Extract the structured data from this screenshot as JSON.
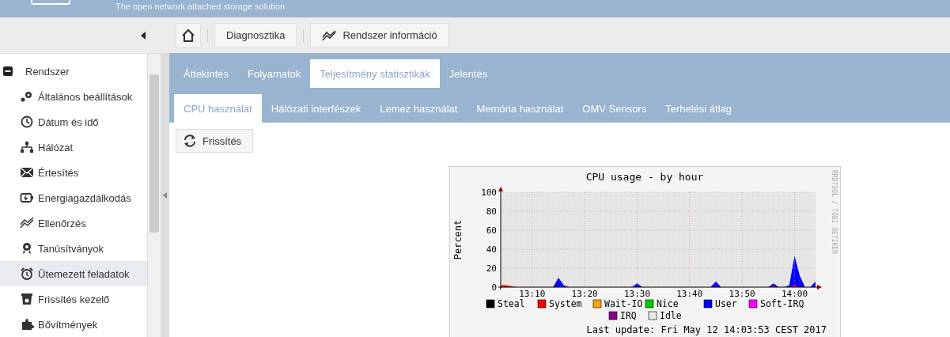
{
  "header": {
    "tagline": "The open network attached storage solution"
  },
  "breadcrumb": [
    {
      "label": "Diagnosztika"
    },
    {
      "label": "Rendszer információ"
    }
  ],
  "sidebar": {
    "group": {
      "label": "Rendszer",
      "expanded": true
    },
    "items": [
      {
        "label": "Általános beállítások",
        "selected": false
      },
      {
        "label": "Dátum és idő",
        "selected": false
      },
      {
        "label": "Hálózat",
        "selected": false
      },
      {
        "label": "Értesítés",
        "selected": false
      },
      {
        "label": "Energiagazdálkodás",
        "selected": false
      },
      {
        "label": "Ellenőrzés",
        "selected": false
      },
      {
        "label": "Tanúsítványok",
        "selected": false
      },
      {
        "label": "Ütemezett feladatok",
        "selected": true
      },
      {
        "label": "Frissítés kezelő",
        "selected": false
      },
      {
        "label": "Bővítmények",
        "selected": false
      }
    ]
  },
  "tabs": [
    {
      "label": "Áttekintés",
      "selected": false
    },
    {
      "label": "Folyamatok",
      "selected": false
    },
    {
      "label": "Teljesítmény statisztikák",
      "selected": true
    },
    {
      "label": "Jelentés",
      "selected": false
    }
  ],
  "subtabs": [
    {
      "label": "CPU használat",
      "selected": true
    },
    {
      "label": "Hálózati interfészek",
      "selected": false
    },
    {
      "label": "Lemez használat",
      "selected": false
    },
    {
      "label": "Memória használat",
      "selected": false
    },
    {
      "label": "OMV Sensors",
      "selected": false
    },
    {
      "label": "Terhelési átlag",
      "selected": false
    }
  ],
  "refresh_button": {
    "label": "Frissítés"
  },
  "graph": {
    "side_label": "RRDTOOL / TOBI OETIKER",
    "last_update": "Last update: Fri May 12 14:03:53 CEST 2017",
    "chart_data": {
      "type": "area",
      "title": "CPU usage - by hour",
      "ylabel": "Percent",
      "stacked": false,
      "grid": true,
      "legend": "bottom",
      "ylim": [
        0,
        100
      ],
      "yticks": [
        0,
        20,
        40,
        60,
        80,
        100
      ],
      "categories": [
        null,
        null,
        null,
        null,
        null,
        null,
        "13:10",
        null,
        null,
        null,
        null,
        null,
        null,
        null,
        null,
        null,
        "13:20",
        null,
        null,
        null,
        null,
        null,
        null,
        null,
        null,
        null,
        "13:30",
        null,
        null,
        null,
        null,
        null,
        null,
        null,
        null,
        null,
        "13:40",
        null,
        null,
        null,
        null,
        null,
        null,
        null,
        null,
        null,
        "13:50",
        null,
        null,
        null,
        null,
        null,
        null,
        null,
        null,
        null,
        "14:00",
        null,
        null,
        null,
        null
      ],
      "series": [
        {
          "name": "System",
          "color": "#ff0000",
          "values": [
            2,
            2,
            1,
            0,
            0,
            0,
            0,
            0,
            0,
            0,
            0,
            0,
            0,
            0,
            0,
            0,
            0,
            0,
            0,
            0,
            0,
            0,
            0,
            0,
            0,
            0,
            0,
            0,
            0,
            0,
            0,
            0,
            0,
            0,
            0,
            0,
            0,
            0,
            0,
            0,
            0,
            0,
            0,
            0,
            0,
            0,
            0,
            0,
            0,
            0,
            0,
            0,
            1,
            0,
            0,
            0,
            2,
            0,
            0,
            0,
            0
          ]
        },
        {
          "name": "User",
          "color": "#0000ff",
          "values": [
            0,
            0,
            0,
            0,
            0,
            0,
            0,
            0,
            0,
            0,
            0,
            10,
            2,
            0,
            0,
            0,
            0,
            0,
            0,
            0,
            0,
            0,
            0,
            0,
            0,
            0,
            4,
            0,
            0,
            0,
            0,
            0,
            0,
            0,
            0,
            0,
            0,
            0,
            0,
            0,
            0,
            6,
            0,
            0,
            0,
            0,
            0,
            0,
            0,
            0,
            0,
            0,
            4,
            0,
            0,
            2,
            33,
            12,
            0,
            0,
            6
          ]
        }
      ]
    },
    "legend": [
      {
        "kind": "key",
        "label": "Steal",
        "color": "#000000"
      },
      {
        "kind": "series"
      },
      {
        "kind": "key",
        "label": "Wait-IO",
        "color": "#ffa500"
      },
      {
        "kind": "key",
        "label": "Nice",
        "color": "#00cc00"
      },
      {
        "kind": "series"
      },
      {
        "kind": "key",
        "label": "Soft-IRQ",
        "color": "#ff00ff"
      },
      {
        "kind": "key",
        "label": "IRQ",
        "color": "#880088"
      },
      {
        "kind": "key",
        "label": "Idle",
        "color": "#e8e8e8"
      }
    ]
  }
}
